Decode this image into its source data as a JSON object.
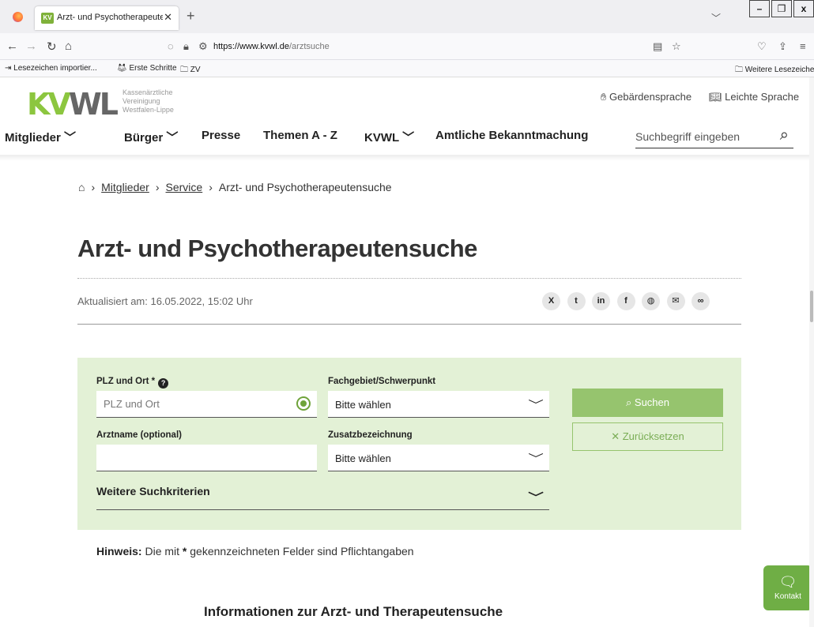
{
  "browser": {
    "tab_title": "Arzt- und Psychotherapeutensu",
    "tab_favicon_text": "KV",
    "url_host": "https://www.kvwl.de",
    "url_path": "/arztsuche",
    "bookmarks": [
      "Lesezeichen importier...",
      "Erste Schritte",
      "ZV",
      "Weitere Lesezeichen"
    ]
  },
  "header": {
    "logo_text_green": "KV",
    "logo_text_grey": "WL",
    "logo_sub": [
      "Kassenärztliche",
      "Vereinigung",
      "Westfalen-Lippe"
    ],
    "sign_language": "Gebärdensprache",
    "easy_language": "Leichte Sprache",
    "nav": [
      "Mitglieder",
      "Bürger",
      "Presse",
      "Themen A - Z",
      "KVWL",
      "Amtliche Bekanntmachung"
    ],
    "search_placeholder": "Suchbegriff eingeben"
  },
  "breadcrumb": [
    "Mitglieder",
    "Service",
    "Arzt- und Psychotherapeutensuche"
  ],
  "page": {
    "title": "Arzt- und Psychotherapeutensuche",
    "updated": "Aktualisiert am: 16.05.2022, 15:02 Uhr"
  },
  "form": {
    "plz_label": "PLZ und Ort *",
    "plz_placeholder": "PLZ und Ort",
    "specialty_label": "Fachgebiet/Schwerpunkt",
    "specialty_value": "Bitte wählen",
    "name_label": "Arztname (optional)",
    "name_value": "",
    "additional_label": "Zusatzbezeichnung",
    "additional_value": "Bitte wählen",
    "more_criteria": "Weitere Suchkriterien",
    "search_button": "Suchen",
    "reset_button": "Zurücksetzen"
  },
  "hint": {
    "label": "Hinweis:",
    "text_before": "Die mit",
    "star": "*",
    "text_after": "gekennzeichneten Felder sind Pflichtangaben"
  },
  "info_heading": "Informationen zur Arzt- und Therapeutensuche",
  "kontakt_label": "Kontakt",
  "colors": {
    "brand_green": "#8cc63f",
    "panel_bg": "#e3f1d6",
    "button_green": "#96c46e"
  }
}
